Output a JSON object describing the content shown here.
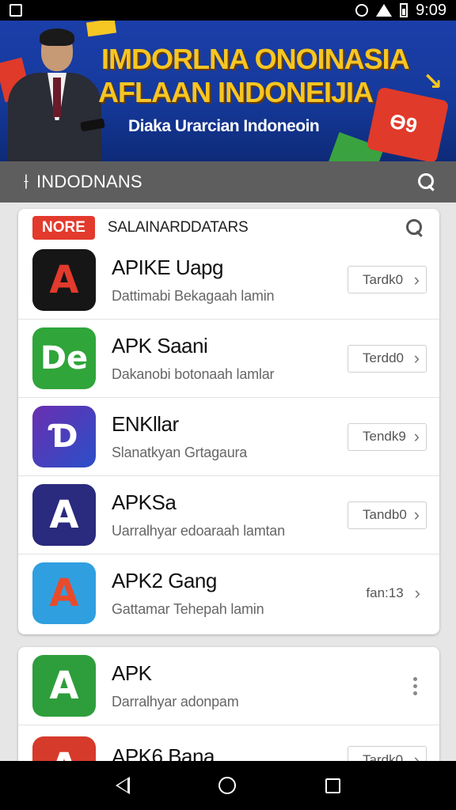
{
  "status_bar": {
    "time": "9:09"
  },
  "banner": {
    "title_line1": "IMDORLNA ONOINASIA",
    "title_line2": "AFLAAN INDONEIJIA",
    "subtitle": "Diaka Urarcian Indoneoin",
    "deco_text": "Ɵ9"
  },
  "appbar": {
    "title": "INDODNANS"
  },
  "section": {
    "badge": "NORE",
    "title": "SALAINARDDATARS"
  },
  "apps": [
    {
      "name": "APIKE Uapg",
      "desc": "Dattimabi Bekagaah lamin",
      "action": "Tardk0",
      "icon_glyph": "A",
      "icon_bg": "#161616",
      "icon_fg": "#e23a2c"
    },
    {
      "name": "APK Saani",
      "desc": "Dakanobi botonaah lamlar",
      "action": "Terdd0",
      "icon_glyph": "De",
      "icon_bg": "#2fa53a",
      "icon_fg": "#ffffff"
    },
    {
      "name": "ENKllar",
      "desc": "Slanatkyan Grtagaura",
      "action": "Tendk9",
      "icon_glyph": "Ɗ",
      "icon_bg": "#3b2a8e",
      "icon_fg": "#ffffff"
    },
    {
      "name": "APKSa",
      "desc": "Uarralhyar edoaraah lamtan",
      "action": "Tandb0",
      "icon_glyph": "A",
      "icon_bg": "#2a2a7e",
      "icon_fg": "#ffffff"
    },
    {
      "name": "APK2 Gang",
      "desc": "Gattamar Tehepah lamin",
      "action": "fan:13",
      "icon_glyph": "A",
      "icon_bg": "#2f9fe0",
      "icon_fg": "#e84b2c"
    }
  ],
  "apps2": [
    {
      "name": "APK",
      "desc": "Darralhyar adonpam",
      "icon_glyph": "A",
      "icon_bg": "#2e9e3c",
      "icon_fg": "#ffffff"
    },
    {
      "name": "APK6 Bana",
      "desc": "",
      "action": "Tardk0",
      "icon_glyph": "A",
      "icon_bg": "#d63a2b",
      "icon_fg": "#ffffff"
    }
  ],
  "colors": {
    "appbar": "#5e5e5e",
    "badge": "#e23a2c",
    "banner_text": "#f6c623",
    "banner_bg": "#1b3ea8"
  },
  "icons": {
    "search": "search-icon",
    "menu": "menu-icon",
    "chevron": "chevron-right-icon",
    "more": "more-vert-icon"
  }
}
